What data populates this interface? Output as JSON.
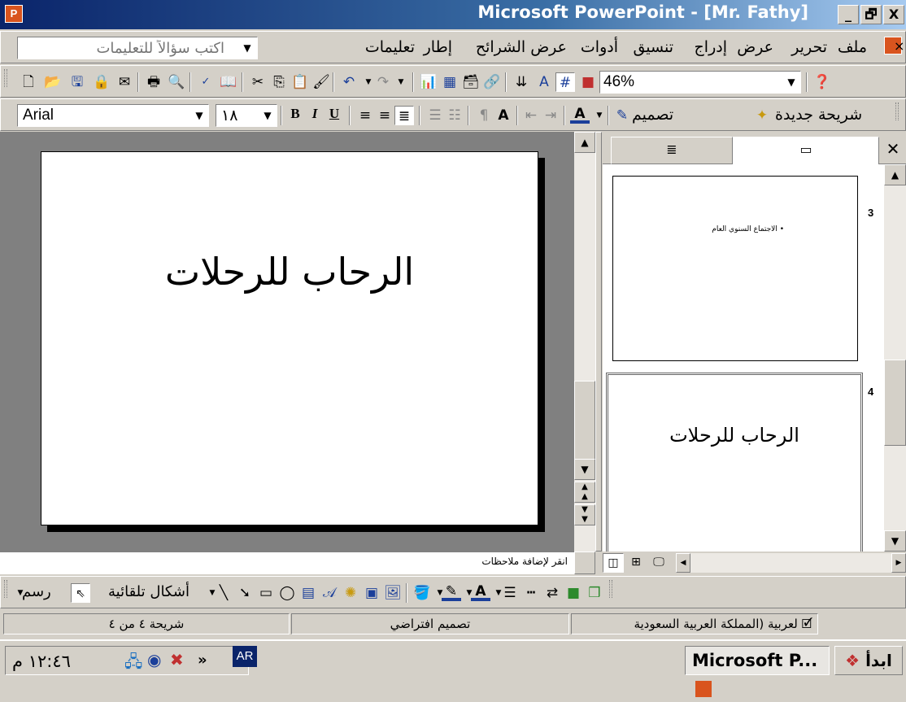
{
  "window": {
    "title": "Microsoft PowerPoint - [Mr. Fathy]",
    "app_icon": "P",
    "min_label": "_",
    "restore_label": "🗗",
    "close_label": "X"
  },
  "menubar": {
    "items": [
      "ملف",
      "تحرير",
      "عرض",
      "إدراج",
      "تنسيق",
      "أدوات",
      "عرض الشرائح",
      "إطار",
      "تعليمات"
    ],
    "close_doc": "×",
    "ask_placeholder": "اكتب سؤالاً للتعليمات"
  },
  "standard_toolbar": {
    "zoom": "46%"
  },
  "format_toolbar": {
    "font": "Arial",
    "font_size": "١٨",
    "bold": "B",
    "italic": "I",
    "underline": "U",
    "new_slide": "شريحة جديدة",
    "design": "تصميم"
  },
  "slide": {
    "title": "الرحاب للرحلات"
  },
  "thumbnails": [
    {
      "number": "3",
      "text": "الاجتماع السنوي العام",
      "bullet": "•"
    },
    {
      "number": "4",
      "text": "الرحاب للرحلات"
    }
  ],
  "notes": {
    "hint": "انقر لإضافة ملاحظات"
  },
  "drawing_toolbar": {
    "draw_label": "رسم",
    "autoshapes_label": "أشكال تلقائية"
  },
  "statusbar": {
    "slide_count": "شريحة ٤ من ٤",
    "design": "تصميم افتراضي",
    "language": "لعربية (المملكة العربية السعودية"
  },
  "taskbar": {
    "start": "ابدأ",
    "app_button": "Microsoft P...",
    "lang_indicator": "AR",
    "clock": "١٢:٤٦ م",
    "chevron": "»"
  }
}
